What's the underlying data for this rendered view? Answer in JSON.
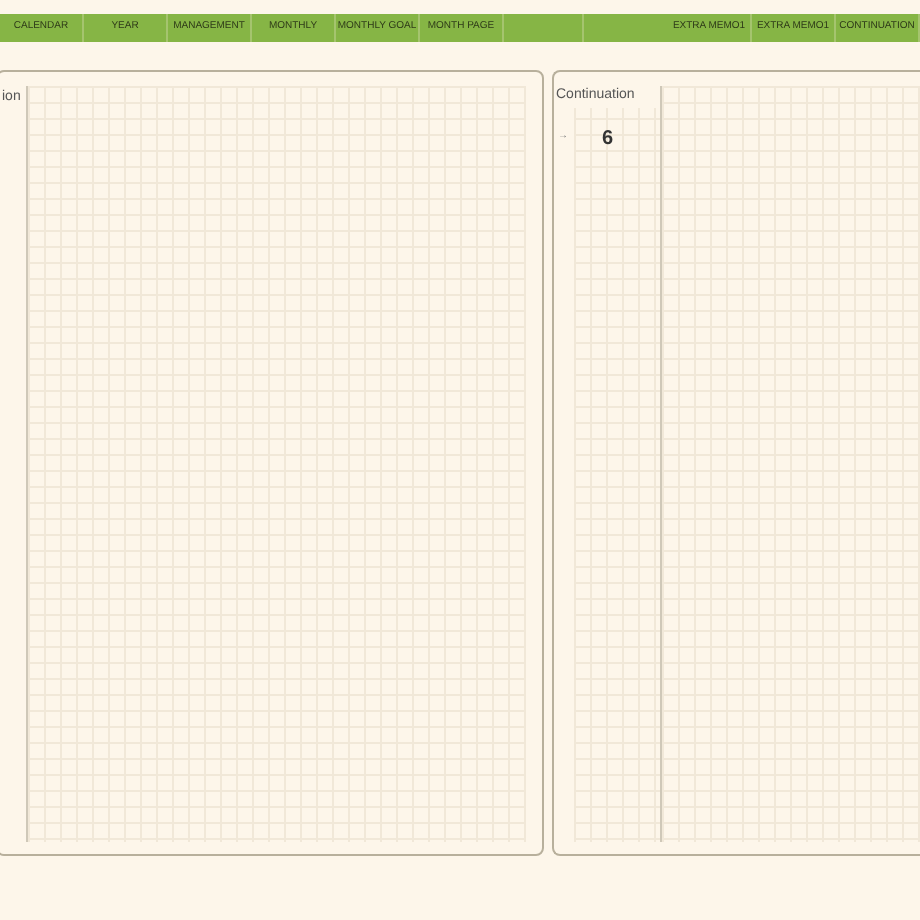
{
  "nav": {
    "left_tabs": [
      {
        "label": "CALENDAR"
      },
      {
        "label": "YEAR"
      },
      {
        "label": "MANAGEMENT"
      },
      {
        "label": "MONTHLY"
      },
      {
        "label": "MONTHLY GOAL"
      },
      {
        "label": "MONTH PAGE"
      }
    ],
    "right_tabs": [
      {
        "label": "EXTRA MEMO1"
      },
      {
        "label": "EXTRA MEMO1"
      },
      {
        "label": "CONTINUATION"
      }
    ]
  },
  "left_page": {
    "title": "ion"
  },
  "right_page": {
    "title": "Continuation",
    "arrow": "→",
    "number": "6"
  }
}
